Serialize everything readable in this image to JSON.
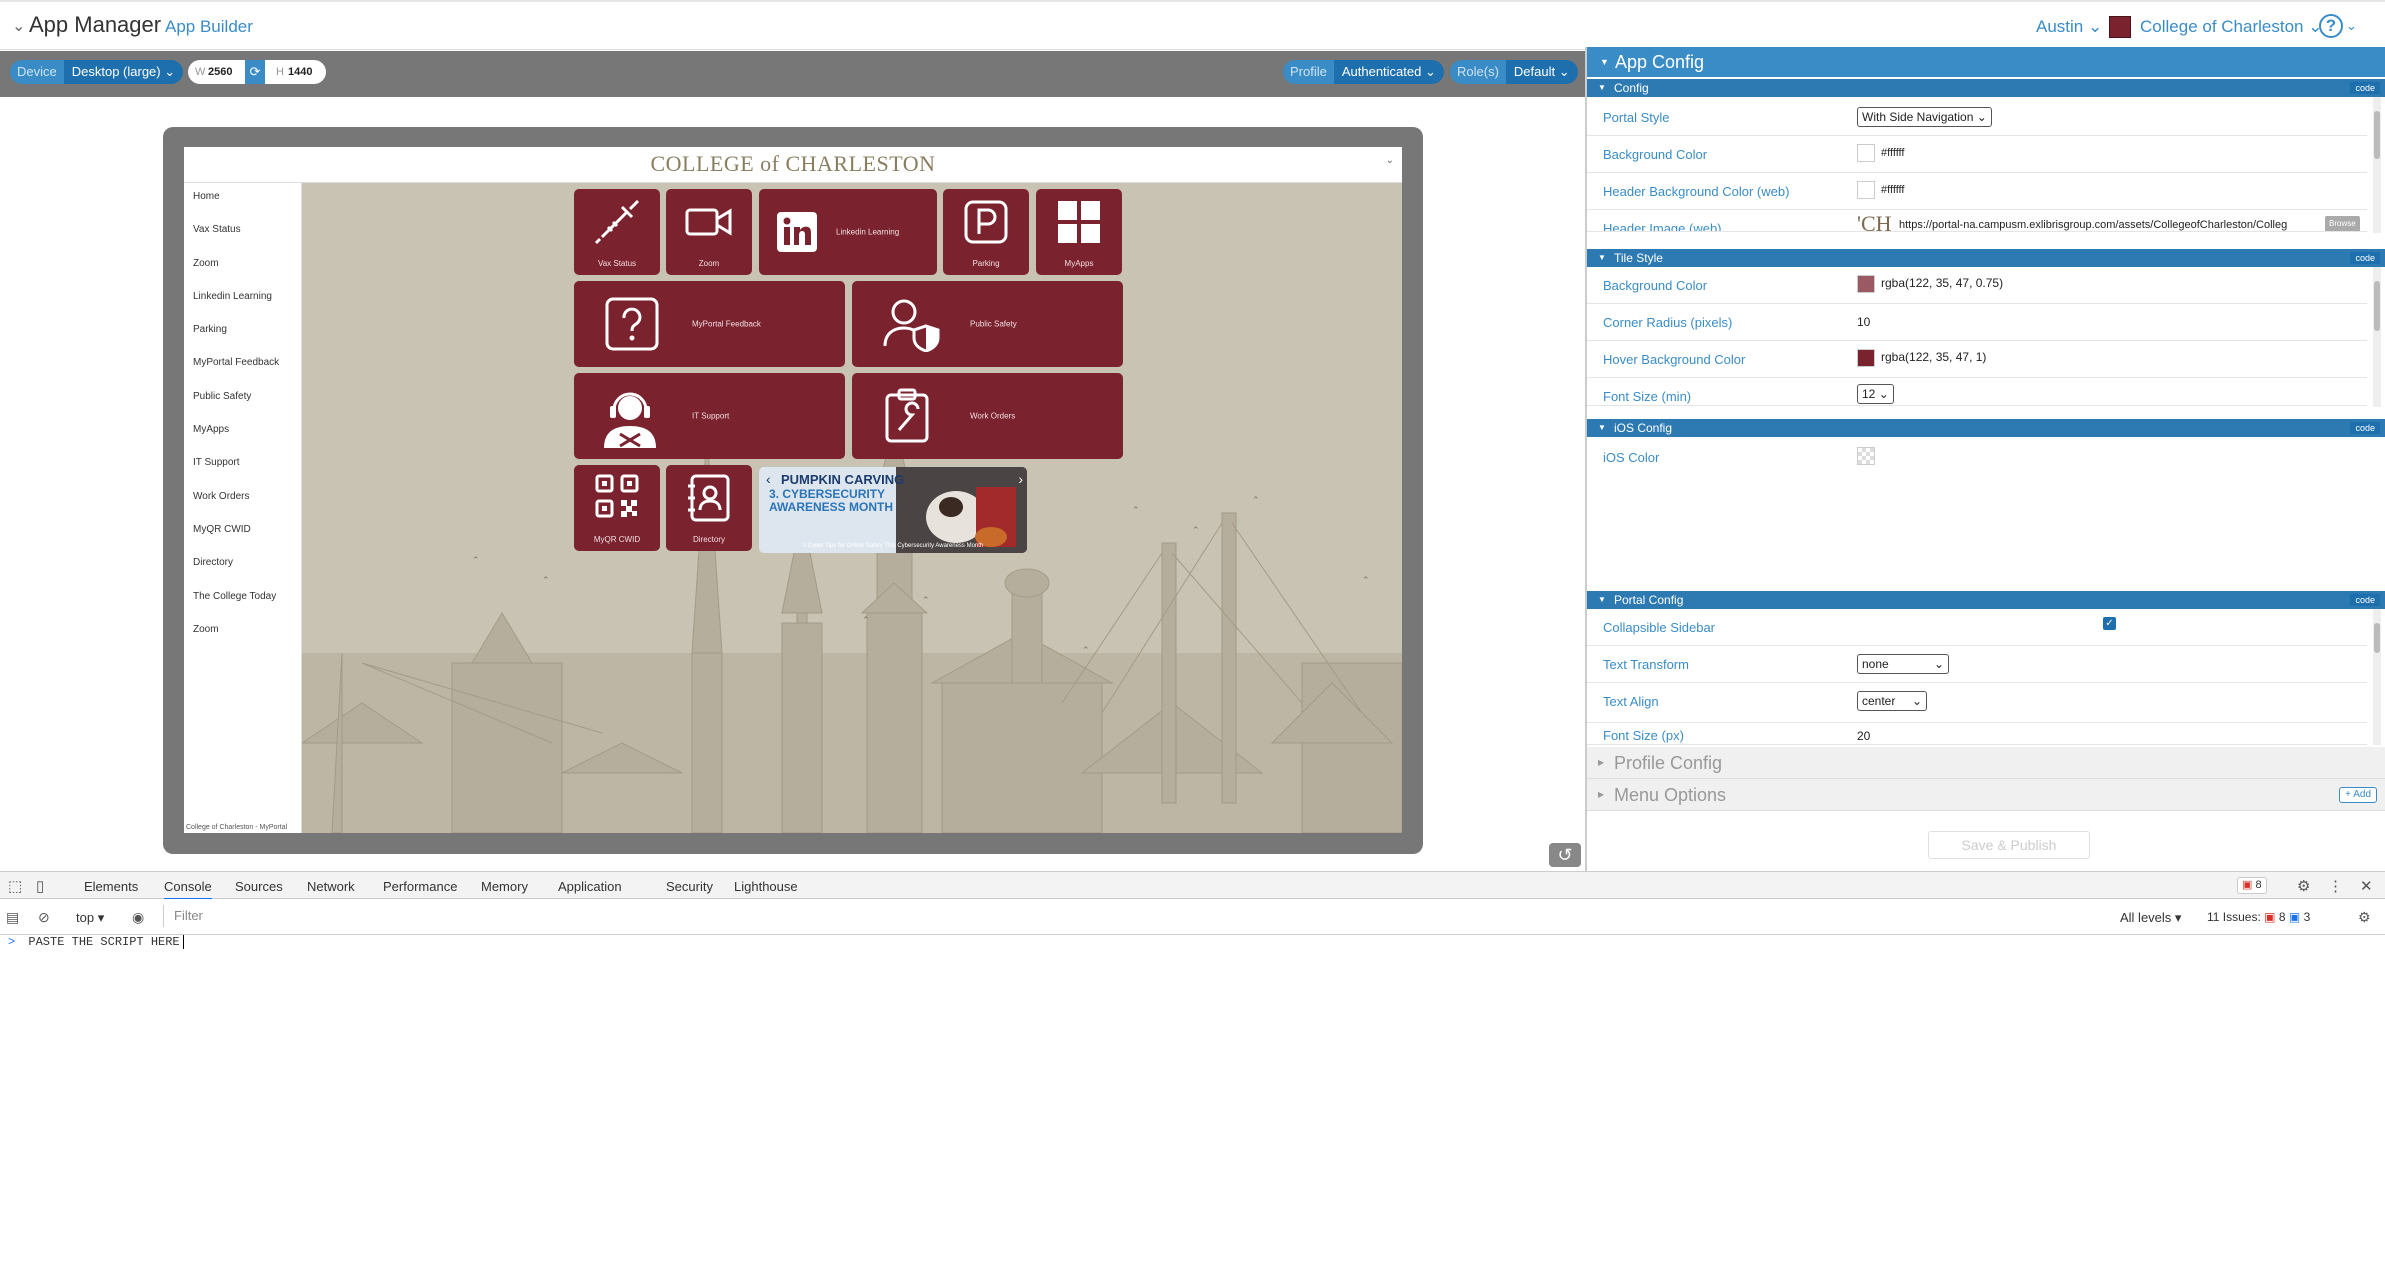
{
  "app": {
    "title": "App Manager",
    "subtitle": "App Builder",
    "user": "Austin",
    "organization": "College of Charleston",
    "help": "?"
  },
  "device_bar": {
    "device_label": "Device",
    "device_value": "Desktop (large)",
    "width_label": "W",
    "width_value": "2560",
    "height_label": "H",
    "height_value": "1440",
    "profile_label": "Profile",
    "profile_value": "Authenticated",
    "roles_label": "Role(s)",
    "roles_value": "Default"
  },
  "preview": {
    "logo": "COLLEGE of CHARLESTON",
    "sidebar_items": [
      "Home",
      "Vax Status",
      "Zoom",
      "Linkedin Learning",
      "Parking",
      "MyPortal Feedback",
      "Public Safety",
      "MyApps",
      "IT Support",
      "Work Orders",
      "MyQR CWID",
      "Directory",
      "The College Today",
      "Zoom"
    ],
    "footer": "College of Charleston - MyPortal",
    "tiles": {
      "vax": "Vax Status",
      "zoom": "Zoom",
      "linkedin": "Linkedin Learning",
      "parking": "Parking",
      "myapps": "MyApps",
      "feedback": "MyPortal Feedback",
      "safety": "Public Safety",
      "it": "IT Support",
      "work": "Work Orders",
      "qr": "MyQR CWID",
      "directory": "Directory"
    },
    "banner": {
      "title": "PUMPKIN CARVING",
      "headline": "3. CYBERSECURITY AWARENESS MONTH",
      "caption": "3 Cyber Tips for Online Safety This Cybersecurity Awareness Month"
    }
  },
  "panel": {
    "title": "App Config",
    "code_label": "code",
    "config": {
      "title": "Config",
      "portal_style_label": "Portal Style",
      "portal_style_value": "With Side Navigation",
      "bg_color_label": "Background Color",
      "bg_color_value": "#ffffff",
      "header_bg_label": "Header Background Color (web)",
      "header_bg_value": "#ffffff",
      "header_image_label": "Header Image (web)",
      "header_image_value": "https://portal-na.campusm.exlibrisgroup.com/assets/CollegeofCharleston/Colleg",
      "header_image_preview": "'CH",
      "browse_label": "Browse"
    },
    "tile_style": {
      "title": "Tile Style",
      "bg_label": "Background Color",
      "bg_value": "rgba(122, 35, 47, 0.75)",
      "radius_label": "Corner Radius (pixels)",
      "radius_value": "10",
      "hover_label": "Hover Background Color",
      "hover_value": "rgba(122, 35, 47, 1)",
      "font_min_label": "Font Size (min)",
      "font_min_value": "12"
    },
    "ios": {
      "title": "iOS Config",
      "color_label": "iOS Color"
    },
    "portal": {
      "title": "Portal Config",
      "collapsible_label": "Collapsible Sidebar",
      "collapsible_checked": true,
      "transform_label": "Text Transform",
      "transform_value": "none",
      "align_label": "Text Align",
      "align_value": "center",
      "font_px_label": "Font Size (px)",
      "font_px_value": "20"
    },
    "profile_config": "Profile Config",
    "menu_options": "Menu Options",
    "add_label": "+ Add",
    "save_label": "Save & Publish"
  },
  "devtools": {
    "tabs": [
      "Elements",
      "Console",
      "Sources",
      "Network",
      "Performance",
      "Memory",
      "Application",
      "Security",
      "Lighthouse"
    ],
    "active_tab": "Console",
    "error_count": "8",
    "context": "top",
    "filter_placeholder": "Filter",
    "levels": "All levels",
    "issues_label": "11 Issues:",
    "issues_errors": "8",
    "issues_messages": "3",
    "console_prompt": ">",
    "console_input": "PASTE THE SCRIPT HERE"
  },
  "colors": {
    "accent": "#3a8cc7",
    "accent_dark": "#1e6fad",
    "tile": "#7a232f",
    "preview_bg": "#c9c3b3"
  }
}
